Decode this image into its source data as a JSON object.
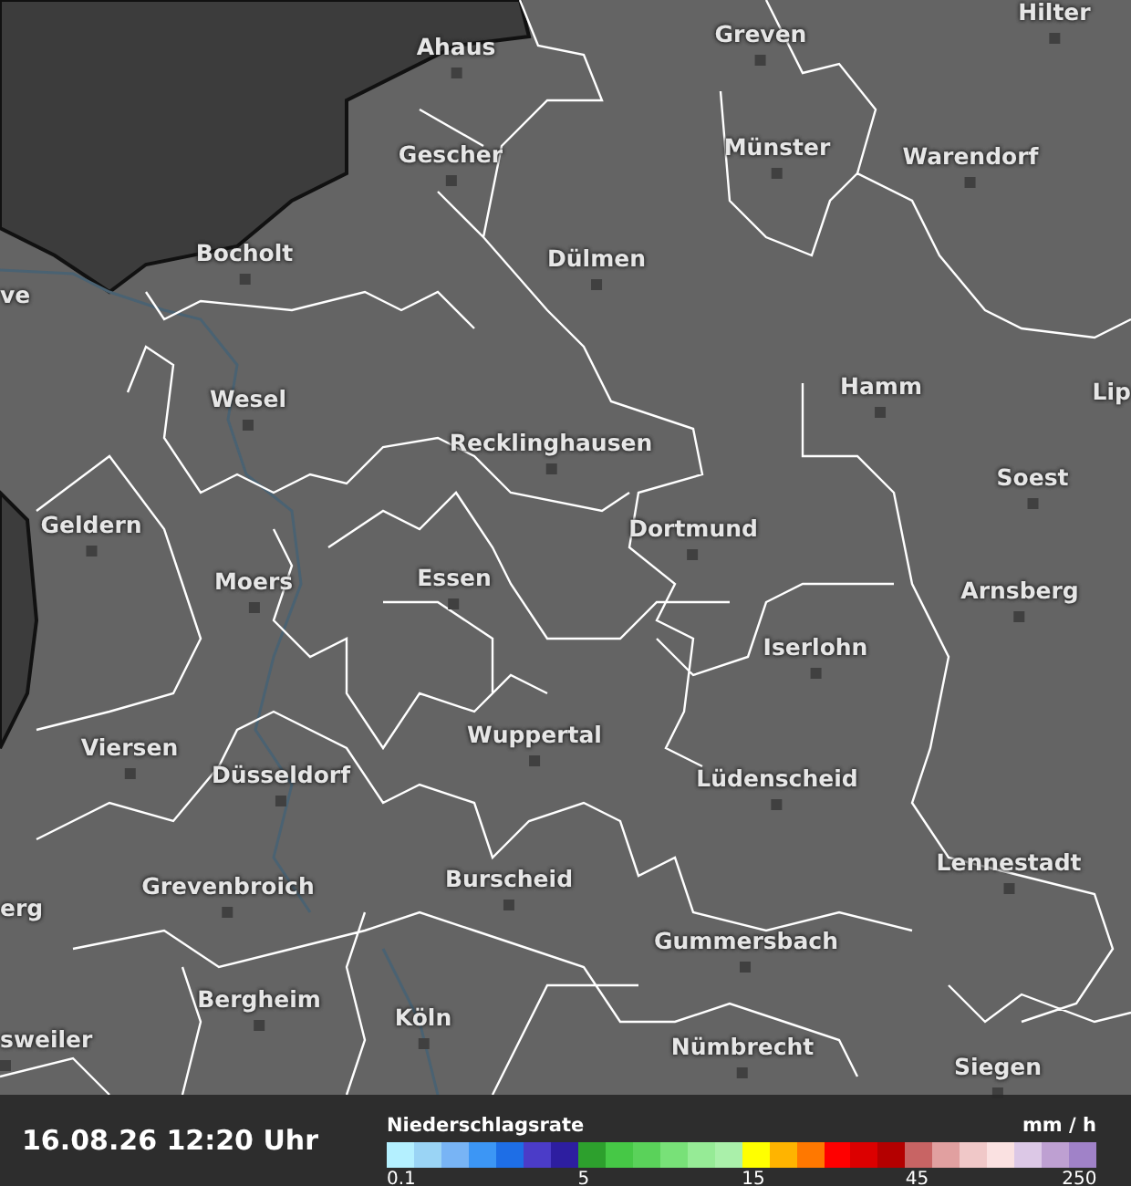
{
  "map": {
    "places": [
      {
        "name": "Ahaus",
        "marker": true
      },
      {
        "name": "Greven",
        "marker": true
      },
      {
        "name": "Hilter",
        "marker": true
      },
      {
        "name": "Gescher",
        "marker": true
      },
      {
        "name": "Münster",
        "marker": true
      },
      {
        "name": "Warendorf",
        "marker": true
      },
      {
        "name": "Bocholt",
        "marker": true
      },
      {
        "name": "Dülmen",
        "marker": true
      },
      {
        "name": "ve",
        "marker": false
      },
      {
        "name": "Wesel",
        "marker": true
      },
      {
        "name": "Hamm",
        "marker": true
      },
      {
        "name": "Lip",
        "marker": false
      },
      {
        "name": "Recklinghausen",
        "marker": true
      },
      {
        "name": "Soest",
        "marker": true
      },
      {
        "name": "Geldern",
        "marker": true
      },
      {
        "name": "Dortmund",
        "marker": true
      },
      {
        "name": "Moers",
        "marker": true
      },
      {
        "name": "Essen",
        "marker": true
      },
      {
        "name": "Arnsberg",
        "marker": true
      },
      {
        "name": "Iserlohn",
        "marker": true
      },
      {
        "name": "Viersen",
        "marker": true
      },
      {
        "name": "Wuppertal",
        "marker": true
      },
      {
        "name": "Düsseldorf",
        "marker": true
      },
      {
        "name": "Lüdenscheid",
        "marker": true
      },
      {
        "name": "Grevenbroich",
        "marker": true
      },
      {
        "name": "Burscheid",
        "marker": true
      },
      {
        "name": "Lennestadt",
        "marker": true
      },
      {
        "name": "erg",
        "marker": false
      },
      {
        "name": "Gummersbach",
        "marker": true
      },
      {
        "name": "Bergheim",
        "marker": true
      },
      {
        "name": "sweiler",
        "marker": true
      },
      {
        "name": "Köln",
        "marker": true
      },
      {
        "name": "Nümbrecht",
        "marker": true
      },
      {
        "name": "Siegen",
        "marker": true
      }
    ]
  },
  "status_bar": {
    "timestamp": "16.08.26 12:20 Uhr",
    "legend": {
      "title": "Niederschlagsrate",
      "unit": "mm / h",
      "end_label": "250",
      "swatches": [
        {
          "color": "#b4f0ff",
          "tick": "0.1"
        },
        {
          "color": "#9ad4f5"
        },
        {
          "color": "#78b4f5"
        },
        {
          "color": "#3c96f5"
        },
        {
          "color": "#1e6ee6"
        },
        {
          "color": "#4b3cc8"
        },
        {
          "color": "#2d1ea0"
        },
        {
          "color": "#2da02d",
          "tick": "5"
        },
        {
          "color": "#46c846"
        },
        {
          "color": "#5ad25a"
        },
        {
          "color": "#78e178"
        },
        {
          "color": "#96eb96"
        },
        {
          "color": "#aaf0aa"
        },
        {
          "color": "#ffff00",
          "tick": "15"
        },
        {
          "color": "#ffb400"
        },
        {
          "color": "#ff7800"
        },
        {
          "color": "#ff0000"
        },
        {
          "color": "#dc0000"
        },
        {
          "color": "#b40000"
        },
        {
          "color": "#c86464",
          "tick": "45"
        },
        {
          "color": "#e1a0a0"
        },
        {
          "color": "#f0c8c8"
        },
        {
          "color": "#fae1e1"
        },
        {
          "color": "#dcc8e6"
        },
        {
          "color": "#bea0d2"
        },
        {
          "color": "#a082c8"
        }
      ]
    }
  }
}
